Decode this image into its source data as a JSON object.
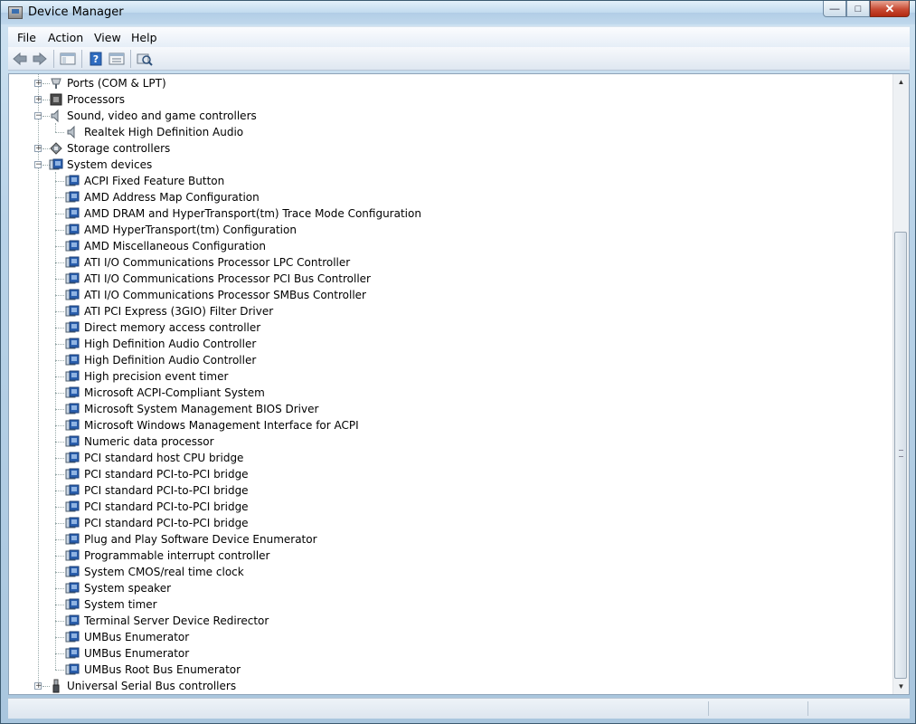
{
  "window": {
    "title": "Device Manager"
  },
  "menu": [
    "File",
    "Action",
    "View",
    "Help"
  ],
  "toolbar": {
    "buttons": [
      "back-icon",
      "forward-icon",
      "show-hide-console-tree-icon",
      "help-icon",
      "properties-icon",
      "scan-for-hardware-changes-icon"
    ]
  },
  "tree": {
    "rows": [
      {
        "label": "Ports (COM & LPT)",
        "level": 0,
        "expander": "+",
        "icon": "port-icon"
      },
      {
        "label": "Processors",
        "level": 0,
        "expander": "+",
        "icon": "processor-icon"
      },
      {
        "label": "Sound, video and game controllers",
        "level": 0,
        "expander": "-",
        "icon": "speaker-icon"
      },
      {
        "label": "Realtek High Definition Audio",
        "level": 1,
        "icon": "speaker-icon"
      },
      {
        "label": "Storage controllers",
        "level": 0,
        "expander": "+",
        "icon": "storage-controller-icon"
      },
      {
        "label": "System devices",
        "level": 0,
        "expander": "-",
        "icon": "system-device-icon"
      },
      {
        "label": "ACPI Fixed Feature Button",
        "level": 1,
        "icon": "system-device-icon"
      },
      {
        "label": "AMD Address Map Configuration",
        "level": 1,
        "icon": "system-device-icon"
      },
      {
        "label": "AMD DRAM and HyperTransport(tm) Trace Mode Configuration",
        "level": 1,
        "icon": "system-device-icon"
      },
      {
        "label": "AMD HyperTransport(tm) Configuration",
        "level": 1,
        "icon": "system-device-icon"
      },
      {
        "label": "AMD Miscellaneous Configuration",
        "level": 1,
        "icon": "system-device-icon"
      },
      {
        "label": "ATI I/O Communications Processor LPC Controller",
        "level": 1,
        "icon": "system-device-icon"
      },
      {
        "label": "ATI I/O Communications Processor PCI Bus Controller",
        "level": 1,
        "icon": "system-device-icon"
      },
      {
        "label": "ATI I/O Communications Processor SMBus Controller",
        "level": 1,
        "icon": "system-device-icon"
      },
      {
        "label": "ATI PCI Express (3GIO) Filter Driver",
        "level": 1,
        "icon": "system-device-icon"
      },
      {
        "label": "Direct memory access controller",
        "level": 1,
        "icon": "system-device-icon"
      },
      {
        "label": "High Definition Audio Controller",
        "level": 1,
        "icon": "system-device-icon"
      },
      {
        "label": "High Definition Audio Controller",
        "level": 1,
        "icon": "system-device-icon"
      },
      {
        "label": "High precision event timer",
        "level": 1,
        "icon": "system-device-icon"
      },
      {
        "label": "Microsoft ACPI-Compliant System",
        "level": 1,
        "icon": "system-device-icon"
      },
      {
        "label": "Microsoft System Management BIOS Driver",
        "level": 1,
        "icon": "system-device-icon"
      },
      {
        "label": "Microsoft Windows Management Interface for ACPI",
        "level": 1,
        "icon": "system-device-icon"
      },
      {
        "label": "Numeric data processor",
        "level": 1,
        "icon": "system-device-icon"
      },
      {
        "label": "PCI standard host CPU bridge",
        "level": 1,
        "icon": "system-device-icon"
      },
      {
        "label": "PCI standard PCI-to-PCI bridge",
        "level": 1,
        "icon": "system-device-icon"
      },
      {
        "label": "PCI standard PCI-to-PCI bridge",
        "level": 1,
        "icon": "system-device-icon"
      },
      {
        "label": "PCI standard PCI-to-PCI bridge",
        "level": 1,
        "icon": "system-device-icon"
      },
      {
        "label": "PCI standard PCI-to-PCI bridge",
        "level": 1,
        "icon": "system-device-icon"
      },
      {
        "label": "Plug and Play Software Device Enumerator",
        "level": 1,
        "icon": "system-device-icon"
      },
      {
        "label": "Programmable interrupt controller",
        "level": 1,
        "icon": "system-device-icon"
      },
      {
        "label": "System CMOS/real time clock",
        "level": 1,
        "icon": "system-device-icon"
      },
      {
        "label": "System speaker",
        "level": 1,
        "icon": "system-device-icon"
      },
      {
        "label": "System timer",
        "level": 1,
        "icon": "system-device-icon"
      },
      {
        "label": "Terminal Server Device Redirector",
        "level": 1,
        "icon": "system-device-icon"
      },
      {
        "label": "UMBus Enumerator",
        "level": 1,
        "icon": "system-device-icon"
      },
      {
        "label": "UMBus Enumerator",
        "level": 1,
        "icon": "system-device-icon"
      },
      {
        "label": "UMBus Root Bus Enumerator",
        "level": 1,
        "icon": "system-device-icon"
      },
      {
        "label": "Universal Serial Bus controllers",
        "level": 0,
        "expander": "+",
        "icon": "usb-icon"
      }
    ]
  },
  "colors": {
    "title_gradient": "#c2dbef",
    "close_button": "#c84a33",
    "system_device_icon": "#2a5fae"
  }
}
